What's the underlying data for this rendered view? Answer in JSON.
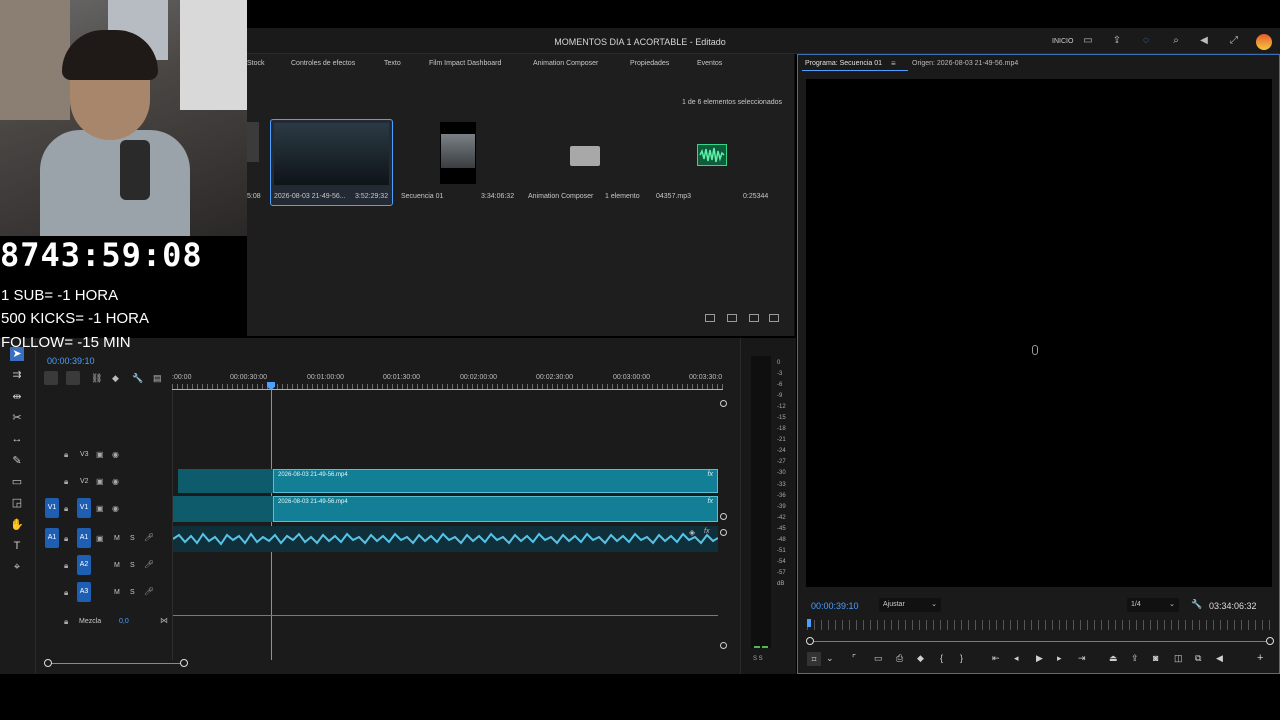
{
  "window": {
    "title": "MOMENTOS DIA 1 ACORTABLE - Editado",
    "inicio": "INICIO"
  },
  "project_panel": {
    "tabs": [
      "Stock",
      "Controles de efectos",
      "Texto",
      "Film Impact Dashboard",
      "Animation Composer",
      "Propiedades",
      "Eventos"
    ],
    "selection_count": "1 de 6 elementos seleccionados",
    "items": [
      {
        "name": "2026-08-03 21-49-56...",
        "duration": "3:52:29:32"
      },
      {
        "name": "Secuencia 01",
        "duration": "3:34:06:32"
      },
      {
        "name": "Animation Composer",
        "duration": "1 elemento"
      },
      {
        "name": "04357.mp3",
        "duration": "0:25344"
      }
    ],
    "partial_item_duration": "5:08"
  },
  "overlay": {
    "timer": "8743:59:08",
    "lines": [
      "1 SUB= -1 HORA",
      "500 KICKS= -1 HORA",
      "FOLLOW= -15 MIN"
    ]
  },
  "timeline": {
    "current_time": "00:00:39:10",
    "ruler": [
      ":00:00",
      "00:00:30:00",
      "00:01:00:00",
      "00:01:30:00",
      "00:02:00:00",
      "00:02:30:00",
      "00:03:00:00",
      "00:03:30:0"
    ],
    "tracks": {
      "video": [
        "V3",
        "V2",
        "V1"
      ],
      "audio": [
        "A1",
        "A2",
        "A3"
      ],
      "source_video": "V1",
      "source_audio": "A1",
      "mix_label": "Mezcla",
      "mix_value": "0,0",
      "m_label": "M",
      "s_label": "S"
    },
    "clips": {
      "v2": "2026-08-03 21-49-56.mp4",
      "v1": "2026-08-03 21-49-56.mp4",
      "fx": "fx"
    }
  },
  "meter": {
    "scale": [
      "0",
      "-3",
      "-6",
      "-9",
      "-12",
      "-15",
      "-18",
      "-21",
      "-24",
      "-27",
      "-30",
      "-33",
      "-36",
      "-39",
      "-42",
      "-45",
      "-48",
      "-51",
      "-54",
      "-57",
      "dB"
    ],
    "solo": "S  S"
  },
  "monitor": {
    "program_tab": "Programa: Secuencia 01",
    "source_tab": "Origen: 2026-08-03 21-49-56.mp4",
    "current_time": "00:00:39:10",
    "fit": "Ajustar",
    "resolution": "1/4",
    "duration": "03:34:06:32"
  },
  "colors": {
    "accent_blue": "#4a9fff",
    "clip_teal": "#137f96",
    "badge_blue": "#1f5fb3"
  }
}
